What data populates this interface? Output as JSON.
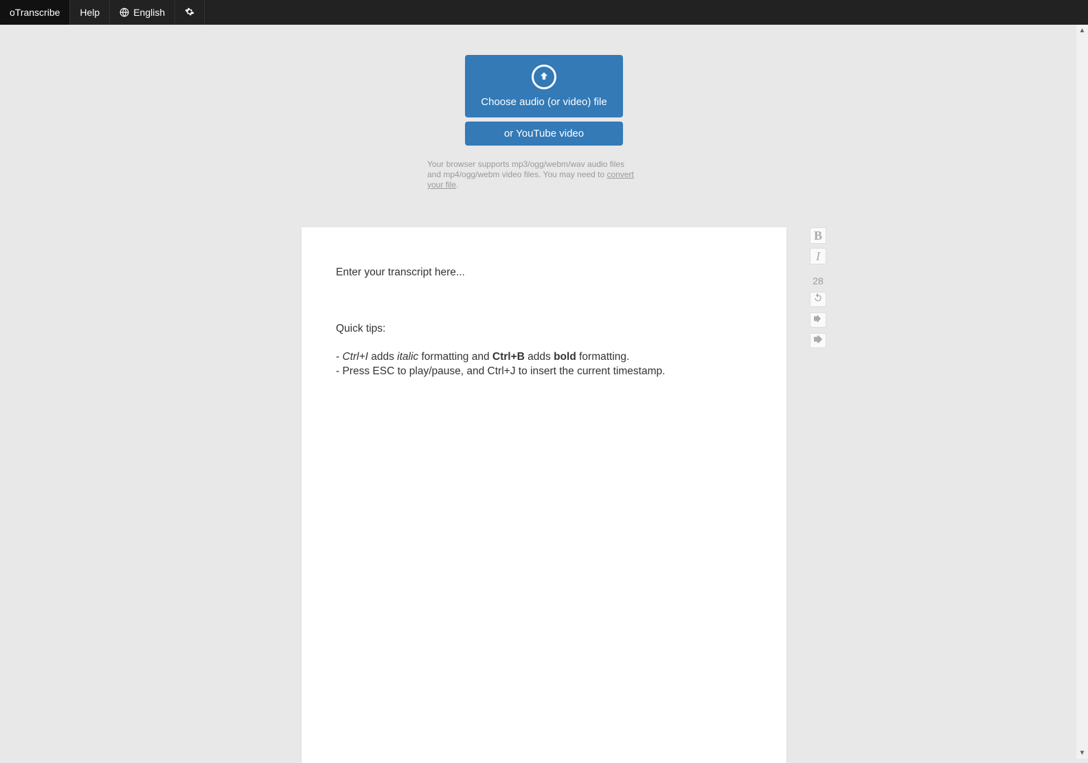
{
  "topbar": {
    "brand": "oTranscribe",
    "help": "Help",
    "language": "English"
  },
  "upload": {
    "choose_label": "Choose audio (or video) file",
    "youtube_label": "or YouTube video",
    "support_prefix": "Your browser supports mp3/ogg/webm/wav audio files and mp4/ogg/webm video files. You may need to ",
    "support_link": "convert your file",
    "support_suffix": "."
  },
  "editor": {
    "placeholder": "Enter your transcript here...",
    "tips_header": "Quick tips:",
    "tip1_prefix": "- ",
    "tip1_ctrl_i": "Ctrl+I",
    "tip1_adds": " adds ",
    "tip1_italic": "italic",
    "tip1_mid": " formatting and ",
    "tip1_ctrl_b": "Ctrl+B",
    "tip1_adds2": " adds ",
    "tip1_bold": "bold",
    "tip1_end": " formatting.",
    "tip2": "- Press ESC to play/pause, and Ctrl+J to insert the current timestamp."
  },
  "sidebar": {
    "bold_label": "B",
    "italic_label": "I",
    "backup_count": "28"
  }
}
